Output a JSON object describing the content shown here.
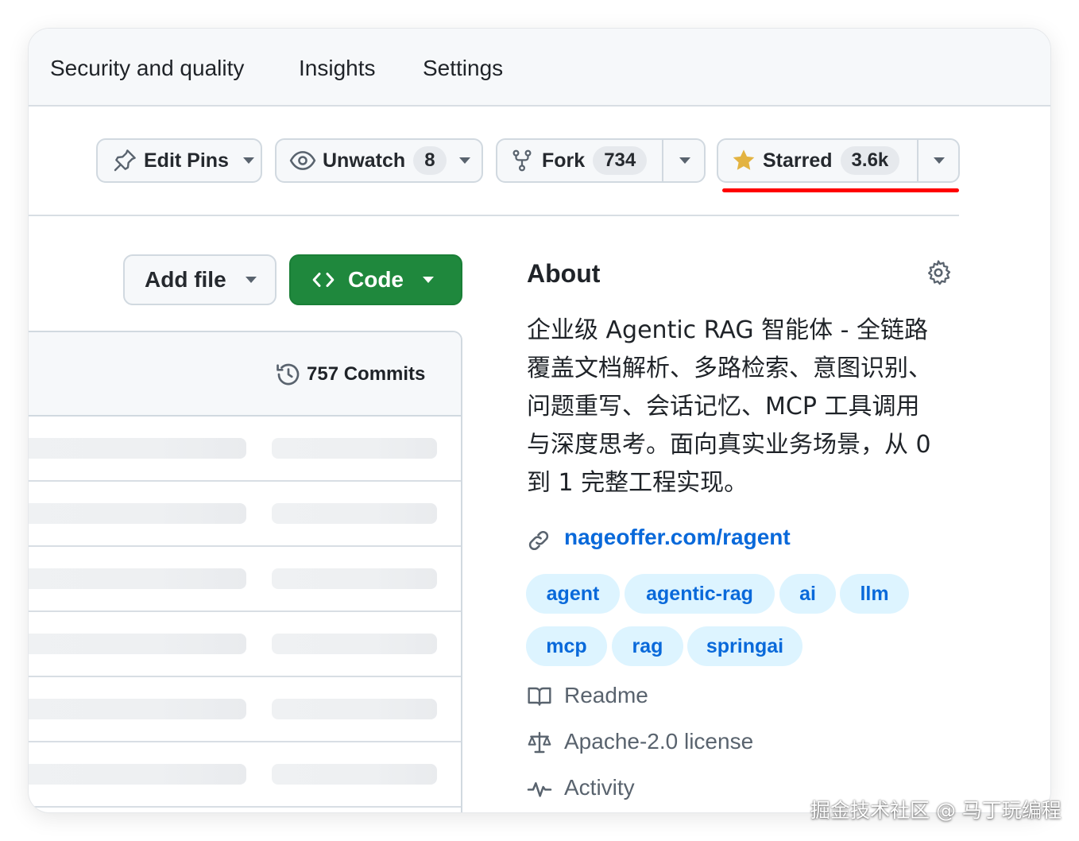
{
  "nav": {
    "items": [
      "Security and quality",
      "Insights",
      "Settings"
    ]
  },
  "actions": {
    "edit_pins": "Edit Pins",
    "unwatch": "Unwatch",
    "watch_count": "8",
    "fork": "Fork",
    "fork_count": "734",
    "starred": "Starred",
    "star_count": "3.6k"
  },
  "files": {
    "add_file": "Add file",
    "code": "Code",
    "commits": "757 Commits"
  },
  "about": {
    "title": "About",
    "description_lines": [
      "企业级 Agentic RAG 智能体 - 全链路",
      "覆盖文档解析、多路检索、意图识别、",
      "问题重写、会话记忆、MCP 工具调用",
      "与深度思考。面向真实业务场景，从 0",
      "到 1 完整工程实现。"
    ],
    "link": "nageoffer.com/ragent",
    "topics": [
      "agent",
      "agentic-rag",
      "ai",
      "llm",
      "mcp",
      "rag",
      "springai"
    ],
    "readme": "Readme",
    "license": "Apache-2.0 license",
    "activity": "Activity"
  },
  "watermark": "掘金技术社区 @ 马丁玩编程",
  "colors": {
    "accent_green": "#1f883d",
    "link_blue": "#0969da",
    "topic_bg": "#ddf4ff",
    "star_yellow": "#e3b341",
    "highlight_red": "#ff0000"
  },
  "icons": [
    "pin-icon",
    "eye-icon",
    "repo-forked-icon",
    "star-fill-icon",
    "code-icon",
    "history-icon",
    "gear-icon",
    "link-icon",
    "book-icon",
    "law-icon",
    "pulse-icon"
  ]
}
